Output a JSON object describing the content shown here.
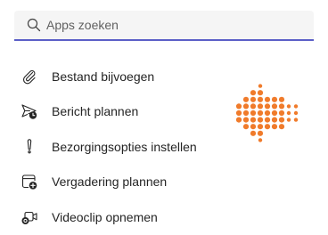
{
  "search": {
    "placeholder": "Apps zoeken",
    "icon": "search-icon"
  },
  "menu": {
    "items": [
      {
        "label": "Bestand bijvoegen",
        "icon": "paperclip-icon"
      },
      {
        "label": "Bericht plannen",
        "icon": "send-clock-icon"
      },
      {
        "label": "Bezorgingsopties instellen",
        "icon": "exclamation-icon"
      },
      {
        "label": "Vergadering plannen",
        "icon": "calendar-add-icon"
      },
      {
        "label": "Videoclip opnemen",
        "icon": "video-clip-icon"
      }
    ]
  },
  "colors": {
    "accent": "#5b5fc7",
    "pointer": "#f07b2b",
    "text": "#242424",
    "search_bg": "#f5f5f5"
  }
}
